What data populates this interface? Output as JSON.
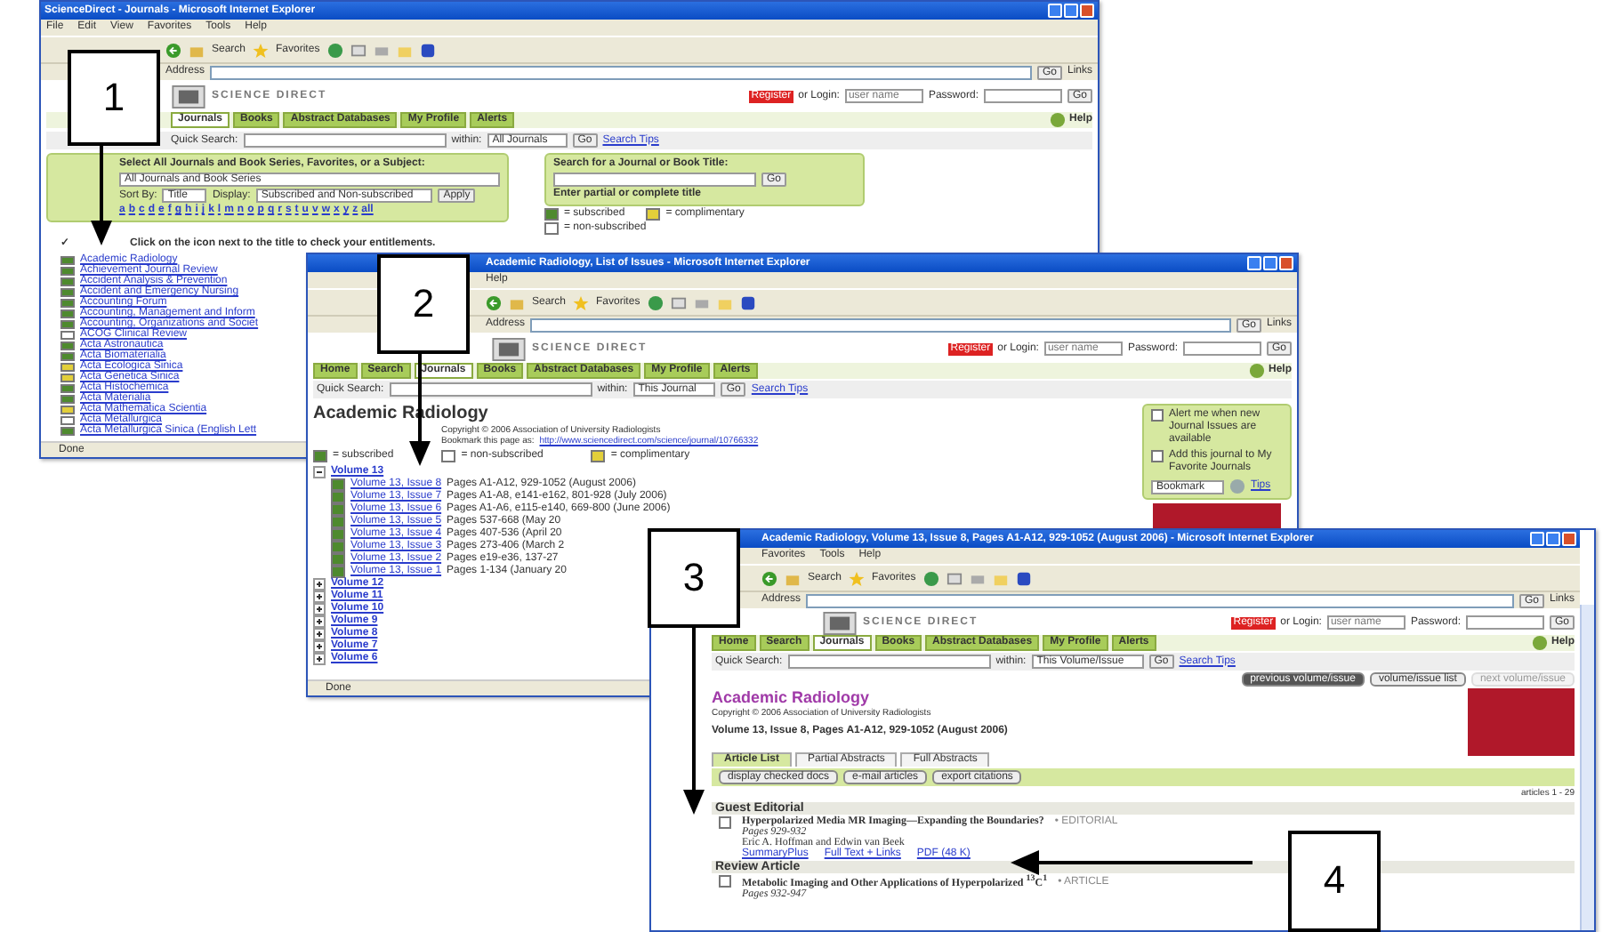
{
  "windows": [
    {
      "kind": "journals",
      "title": "ScienceDirect - Journals - Microsoft Internet Explorer",
      "menu": [
        "File",
        "Edit",
        "View",
        "Favorites",
        "Tools",
        "Help"
      ],
      "toolbar": [
        "Search",
        "Favorites"
      ],
      "address": {
        "label": "Address",
        "go": "Go",
        "links": "Links"
      },
      "logo": "SCIENCE DIRECT",
      "login": {
        "register": "Register",
        "or": "or Login:",
        "user": "user name",
        "password": "Password:",
        "go": "Go"
      },
      "nav": {
        "tabs": [
          {
            "label": "Journals",
            "selected": true
          },
          {
            "label": "Books",
            "selected": false
          },
          {
            "label": "Abstract Databases",
            "selected": false
          },
          {
            "label": "My Profile",
            "selected": false
          },
          {
            "label": "Alerts",
            "selected": false
          }
        ],
        "help": "Help"
      },
      "quick": {
        "label": "Quick Search:",
        "within": "within:",
        "scope": "All Journals",
        "go": "Go",
        "tips": "Search Tips"
      },
      "filter": {
        "heading": "Select All Journals and Book Series, Favorites, or a Subject:",
        "scope": "All Journals and Book Series",
        "sort_label": "Sort By:",
        "sort": "Title",
        "display_label": "Display:",
        "display": "Subscribed and Non-subscribed",
        "apply": "Apply"
      },
      "alphabet": [
        "a",
        "b",
        "c",
        "d",
        "e",
        "f",
        "g",
        "h",
        "i",
        "j",
        "k",
        "l",
        "m",
        "n",
        "o",
        "p",
        "q",
        "r",
        "s",
        "t",
        "u",
        "v",
        "w",
        "x",
        "y",
        "z",
        "all"
      ],
      "note_mark": "✓",
      "note": "Click on the icon next to the title to check your entitlements.",
      "title_search": {
        "heading": "Search for a Journal or Book Title:",
        "go": "Go",
        "hint": "Enter partial or complete title"
      },
      "legend": [
        {
          "label": "= subscribed",
          "color": "#4e8a2e"
        },
        {
          "label": "= complimentary",
          "color": "#e2cf3a"
        },
        {
          "label": "= non-subscribed",
          "color": "#ffffff"
        }
      ],
      "journals": [
        {
          "name": "Academic Radiology",
          "color": "#4e8a2e"
        },
        {
          "name": "Achievement Journal Review",
          "color": "#4e8a2e"
        },
        {
          "name": "Accident Analysis & Prevention",
          "color": "#4e8a2e"
        },
        {
          "name": "Accident and Emergency Nursing",
          "color": "#4e8a2e"
        },
        {
          "name": "Accounting Forum",
          "color": "#4e8a2e"
        },
        {
          "name": "Accounting, Management and Inform",
          "color": "#4e8a2e"
        },
        {
          "name": "Accounting, Organizations and Societ",
          "color": "#4e8a2e"
        },
        {
          "name": "ACOG Clinical Review",
          "color": "#ffffff"
        },
        {
          "name": "Acta Astronautica",
          "color": "#4e8a2e"
        },
        {
          "name": "Acta Biomaterialia",
          "color": "#4e8a2e"
        },
        {
          "name": "Acta Ecologica Sinica",
          "color": "#e2cf3a"
        },
        {
          "name": "Acta Genetica Sinica",
          "color": "#e2cf3a"
        },
        {
          "name": "Acta Histochemica",
          "color": "#4e8a2e"
        },
        {
          "name": "Acta Materialia",
          "color": "#4e8a2e"
        },
        {
          "name": "Acta Mathematica Scientia",
          "color": "#e2cf3a"
        },
        {
          "name": "Acta Metallurgica",
          "color": "#ffffff"
        },
        {
          "name": "Acta Metallurgica Sinica (English Lett",
          "color": "#4e8a2e"
        }
      ],
      "status": "Done"
    },
    {
      "kind": "issues",
      "title": "Academic Radiology, List of Issues - Microsoft Internet Explorer",
      "menu": [
        "Help"
      ],
      "toolbar": [
        "Search",
        "Favorites"
      ],
      "address": {
        "label": "Address",
        "go": "Go",
        "links": "Links"
      },
      "logo": "SCIENCE DIRECT",
      "login": {
        "register": "Register",
        "or": "or Login:",
        "user": "user name",
        "password": "Password:",
        "go": "Go"
      },
      "nav": {
        "tabs": [
          {
            "label": "Home",
            "selected": false
          },
          {
            "label": "Search",
            "selected": false
          },
          {
            "label": "Journals",
            "selected": true
          },
          {
            "label": "Books",
            "selected": false
          },
          {
            "label": "Abstract Databases",
            "selected": false
          },
          {
            "label": "My Profile",
            "selected": false
          },
          {
            "label": "Alerts",
            "selected": false
          }
        ],
        "help": "Help"
      },
      "quick": {
        "label": "Quick Search:",
        "within": "within:",
        "scope": "This Journal",
        "go": "Go",
        "tips": "Search Tips"
      },
      "heading": "Academic Radiology",
      "copyright": "Copyright © 2006 Association of University Radiologists",
      "bookmark": "Bookmark this page as:",
      "url": "http://www.sciencedirect.com/science/journal/10766332",
      "legend": [
        {
          "label": "= subscribed",
          "color": "#4e8a2e"
        },
        {
          "label": "= non-subscribed",
          "color": "#ffffff"
        },
        {
          "label": "= complimentary",
          "color": "#e2cf3a"
        }
      ],
      "volumes": [
        {
          "label": "Volume 13",
          "expanded": true,
          "issues": [
            {
              "link": "Volume 13, Issue 8",
              "pages": "Pages A1-A12, 929-1052 (August 2006)",
              "color": "#4e8a2e"
            },
            {
              "link": "Volume 13, Issue 7",
              "pages": "Pages A1-A8, e141-e162, 801-928 (July 2006)",
              "color": "#4e8a2e"
            },
            {
              "link": "Volume 13, Issue 6",
              "pages": "Pages A1-A6, e115-e140, 669-800 (June 2006)",
              "color": "#4e8a2e"
            },
            {
              "link": "Volume 13, Issue 5",
              "pages": "Pages 537-668 (May 20",
              "color": "#4e8a2e"
            },
            {
              "link": "Volume 13, Issue 4",
              "pages": "Pages 407-536 (April 20",
              "color": "#4e8a2e"
            },
            {
              "link": "Volume 13, Issue 3",
              "pages": "Pages 273-406 (March 2",
              "color": "#4e8a2e"
            },
            {
              "link": "Volume 13, Issue 2",
              "pages": "Pages e19-e36, 137-27",
              "color": "#4e8a2e"
            },
            {
              "link": "Volume 13, Issue 1",
              "pages": "Pages 1-134 (January 20",
              "color": "#4e8a2e"
            }
          ]
        },
        {
          "label": "Volume 12",
          "expanded": false
        },
        {
          "label": "Volume 11",
          "expanded": false
        },
        {
          "label": "Volume 10",
          "expanded": false
        },
        {
          "label": "Volume 9",
          "expanded": false
        },
        {
          "label": "Volume 8",
          "expanded": false
        },
        {
          "label": "Volume 7",
          "expanded": false
        },
        {
          "label": "Volume 6",
          "expanded": false
        }
      ],
      "side": {
        "options": [
          {
            "label": "Alert me when new Journal Issues are available",
            "checked": false
          },
          {
            "label": "Add this journal to My Favorite Journals",
            "checked": false
          }
        ],
        "select": "Bookmark",
        "tips": "Tips"
      },
      "status": "Done"
    },
    {
      "kind": "articles",
      "title": "Academic Radiology, Volume 13, Issue 8, Pages A1-A12, 929-1052 (August 2006) - Microsoft Internet Explorer",
      "menu": [
        "Favorites",
        "Tools",
        "Help"
      ],
      "toolbar": [
        "Search",
        "Favorites"
      ],
      "address": {
        "label": "Address",
        "go": "Go",
        "links": "Links"
      },
      "logo": "SCIENCE DIRECT",
      "login": {
        "register": "Register",
        "or": "or Login:",
        "user": "user name",
        "password": "Password:",
        "go": "Go"
      },
      "nav": {
        "tabs": [
          {
            "label": "Home",
            "selected": false
          },
          {
            "label": "Search",
            "selected": false
          },
          {
            "label": "Journals",
            "selected": true
          },
          {
            "label": "Books",
            "selected": false
          },
          {
            "label": "Abstract Databases",
            "selected": false
          },
          {
            "label": "My Profile",
            "selected": false
          },
          {
            "label": "Alerts",
            "selected": false
          }
        ],
        "help": "Help"
      },
      "quick": {
        "label": "Quick Search:",
        "within": "within:",
        "scope": "This Volume/Issue",
        "go": "Go",
        "tips": "Search Tips"
      },
      "issue_nav": [
        {
          "label": "previous volume/issue",
          "disabled": false
        },
        {
          "label": "volume/issue list",
          "disabled": false
        },
        {
          "label": "next volume/issue",
          "disabled": true
        }
      ],
      "heading": "Academic Radiology",
      "copyright": "Copyright © 2006 Association of University Radiologists",
      "issue": "Volume 13, Issue 8, Pages A1-A12, 929-1052 (August 2006)",
      "view_tabs": [
        {
          "label": "Article List",
          "selected": true
        },
        {
          "label": "Partial Abstracts",
          "selected": false
        },
        {
          "label": "Full Abstracts",
          "selected": false
        }
      ],
      "actions": [
        "display checked docs",
        "e-mail articles",
        "export citations"
      ],
      "count": "articles 1 - 29",
      "sections": [
        {
          "heading": "Guest Editorial",
          "articles": [
            {
              "title": "Hyperpolarized Media MR Imaging—Expanding the Boundaries?",
              "type": "• EDITORIAL",
              "pages": "Pages 929-932",
              "authors": "Eric A. Hoffman and Edwin van Beek",
              "links": [
                "SummaryPlus",
                "Full Text + Links",
                "PDF (48 K)"
              ],
              "checked": false
            }
          ]
        },
        {
          "heading": "Review Article",
          "articles": [
            {
              "title": "Metabolic Imaging and Other Applications of Hyperpolarized $^{13}$C$^{1}$",
              "type": "• ARTICLE",
              "pages": "Pages 932-947",
              "checked": false
            }
          ]
        }
      ]
    }
  ],
  "callouts": [
    {
      "label": "1"
    },
    {
      "label": "2"
    },
    {
      "label": "3"
    },
    {
      "label": "4"
    }
  ]
}
